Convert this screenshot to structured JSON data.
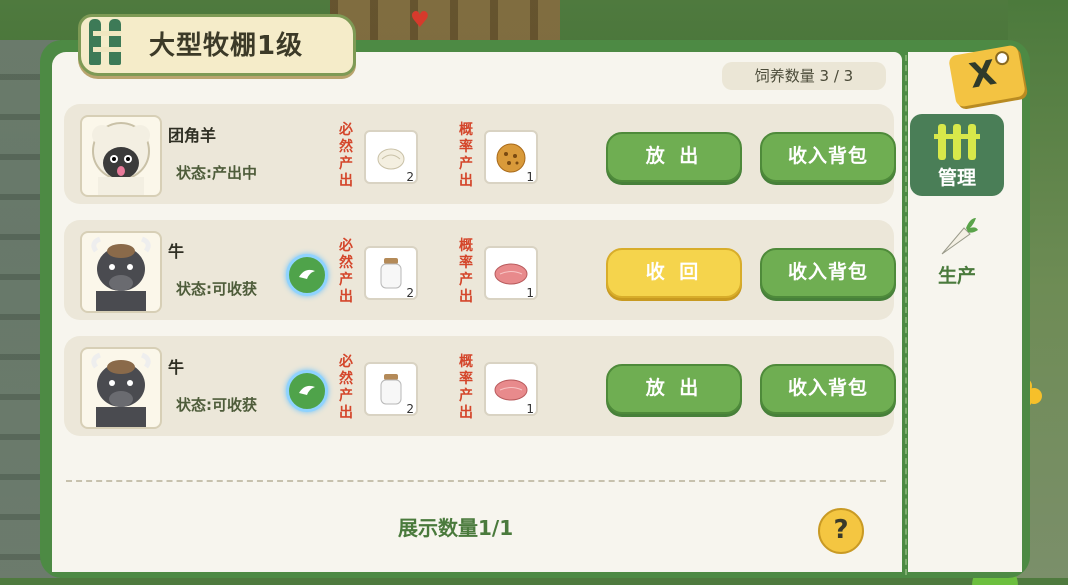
{
  "title": "大型牧棚1级",
  "capacity": "饲养数量 3 / 3",
  "close_label": "X",
  "rows": [
    {
      "name": "团角羊",
      "status": "状态:产出中",
      "has_badge": false,
      "guaranteed_label": "必然产出",
      "guaranteed_qty": "2",
      "guaranteed_icon": "wool-icon",
      "chance_label": "概率产出",
      "chance_qty": "1",
      "chance_icon": "cookie-icon",
      "primary_button": "放 出",
      "primary_style": "green",
      "secondary_button": "收入背包",
      "animal": "sheep"
    },
    {
      "name": "牛",
      "status": "状态:可收获",
      "has_badge": true,
      "guaranteed_label": "必然产出",
      "guaranteed_qty": "2",
      "guaranteed_icon": "milk-bottle-icon",
      "chance_label": "概率产出",
      "chance_qty": "1",
      "chance_icon": "meat-icon",
      "primary_button": "收 回",
      "primary_style": "yellow",
      "secondary_button": "收入背包",
      "animal": "cow"
    },
    {
      "name": "牛",
      "status": "状态:可收获",
      "has_badge": true,
      "guaranteed_label": "必然产出",
      "guaranteed_qty": "2",
      "guaranteed_icon": "milk-bottle-icon",
      "chance_label": "概率产出",
      "chance_qty": "1",
      "chance_icon": "meat-icon",
      "primary_button": "放 出",
      "primary_style": "green",
      "secondary_button": "收入背包",
      "animal": "cow"
    }
  ],
  "display_count": "展示数量1/1",
  "help_label": "?",
  "sidebar": {
    "tabs": [
      {
        "label": "管理",
        "icon": "fence-icon",
        "active": true
      },
      {
        "label": "生产",
        "icon": "carrot-icon",
        "active": false
      }
    ]
  },
  "colors": {
    "panel_green": "#4d8a44",
    "button_green": "#6fae52",
    "button_yellow": "#f5d44c",
    "output_label_red": "#d4462b"
  }
}
